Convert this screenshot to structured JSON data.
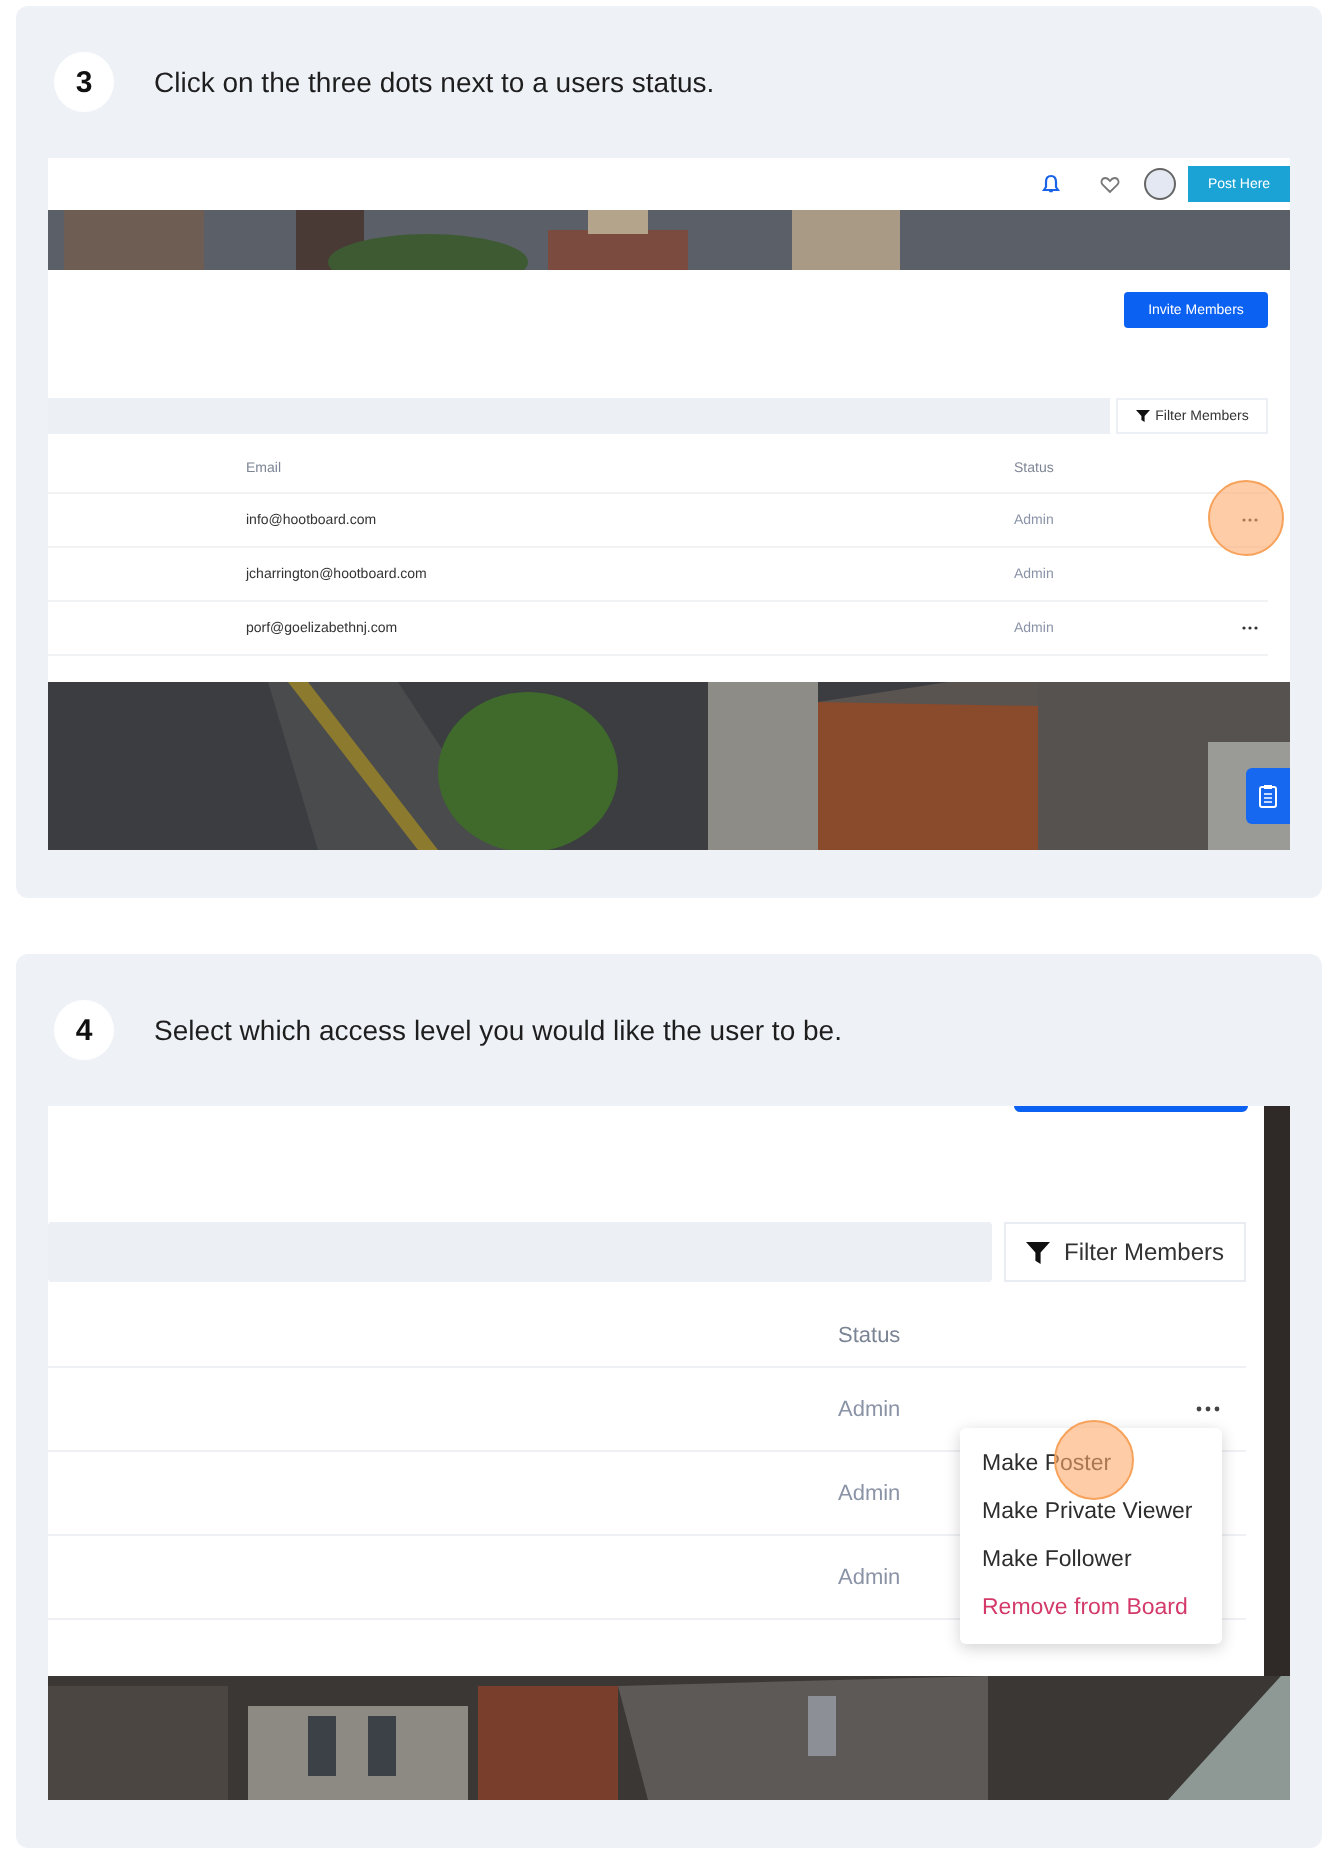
{
  "steps": [
    {
      "number": "3",
      "instruction": "Click on the three dots next to a users status.",
      "screenshot": {
        "kind": "full_view",
        "post_button": "Post Here",
        "invite_button": "Invite Members",
        "filter_button": "Filter Members",
        "columns": [
          "Email",
          "Status"
        ],
        "rows": [
          {
            "email": "info@hootboard.com",
            "status": "Admin",
            "menu_button": true,
            "highlighted": true
          },
          {
            "email": "jcharrington@hootboard.com",
            "status": "Admin",
            "menu_button": false,
            "highlighted": false
          },
          {
            "email": "porf@goelizabethnj.com",
            "status": "Admin",
            "menu_button": true,
            "highlighted": false
          }
        ]
      }
    },
    {
      "number": "4",
      "instruction": "Select which access level you would like the user to be.",
      "screenshot": {
        "kind": "menu_view",
        "filter_button": "Filter Members",
        "columns": [
          "Status"
        ],
        "rows": [
          {
            "status": "Admin",
            "menu_button": true,
            "highlighted": false
          },
          {
            "status": "Admin",
            "menu_button": false,
            "highlighted": false
          },
          {
            "status": "Admin",
            "menu_button": false,
            "highlighted": false
          }
        ],
        "menu": [
          {
            "label": "Make Poster",
            "kind": "action",
            "highlighted": true
          },
          {
            "label": "Make Private Viewer",
            "kind": "action",
            "highlighted": false
          },
          {
            "label": "Make Follower",
            "kind": "action",
            "highlighted": false
          },
          {
            "label": "Remove from Board",
            "kind": "danger",
            "highlighted": false
          }
        ]
      }
    }
  ]
}
